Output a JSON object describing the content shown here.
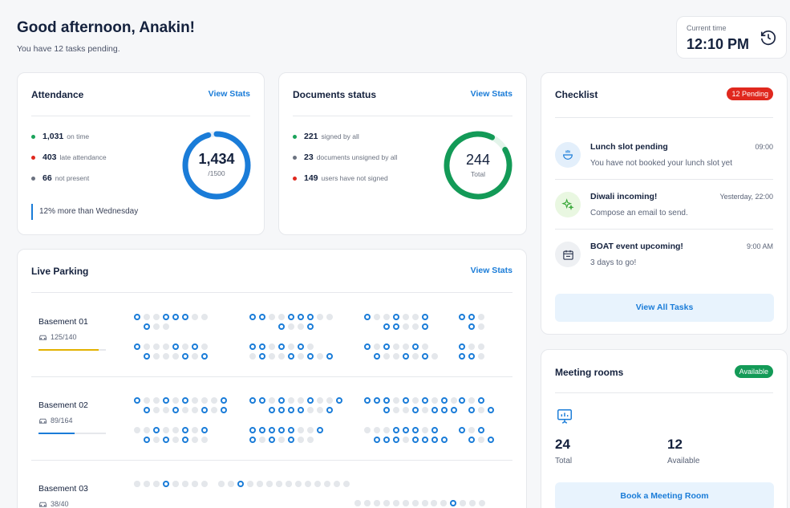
{
  "greeting": {
    "title": "Good afternoon, Anakin!",
    "subtitle": "You have 12 tasks pending."
  },
  "time": {
    "label": "Current time",
    "value": "12:10 PM",
    "icon": "clock-icon"
  },
  "attendance": {
    "title": "Attendance",
    "action": "View Stats",
    "rows": [
      {
        "value": "1,031",
        "label": "on time",
        "color": "#1aa35a"
      },
      {
        "value": "403",
        "label": "late attendance",
        "color": "#e0281e"
      },
      {
        "value": "66",
        "label": "not present",
        "color": "#6b7280"
      }
    ],
    "total": "1,434",
    "total_sub": "/1500",
    "ratio": 0.956,
    "note": "12% more than Wednesday"
  },
  "documents": {
    "title": "Documents status",
    "action": "View Stats",
    "rows": [
      {
        "value": "221",
        "label": "signed by all",
        "color": "#1aa35a"
      },
      {
        "value": "23",
        "label": "documents unsigned by all",
        "color": "#6b7280"
      },
      {
        "value": "149",
        "label": "users have not signed",
        "color": "#e0281e"
      }
    ],
    "total": "244",
    "total_sub": "Total",
    "ratio": 0.906
  },
  "checklist": {
    "title": "Checklist",
    "badge": "12 Pending",
    "items": [
      {
        "title": "Lunch slot pending",
        "sub": "You have not booked your lunch slot yet",
        "time": "09:00",
        "icon": "food-bowl-icon",
        "bg": "#e3effb"
      },
      {
        "title": "Diwali incoming!",
        "sub": "Compose an email to send.",
        "time": "Yesterday, 22:00",
        "icon": "sparkle-icon",
        "bg": "#e9f7e1"
      },
      {
        "title": "BOAT event upcoming!",
        "sub": "3 days to go!",
        "time": "9:00 AM",
        "icon": "calendar-icon",
        "bg": "#eef0f3"
      }
    ],
    "button": "View All Tasks"
  },
  "parking": {
    "title": "Live Parking",
    "action": "View Stats",
    "basements": [
      {
        "name": "Basement 01",
        "capacity": "125/140",
        "ratio": 0.89,
        "color": "#e2b100"
      },
      {
        "name": "Basement 02",
        "capacity": "89/164",
        "ratio": 0.54,
        "color": "#1a7cd8"
      },
      {
        "name": "Basement 03",
        "capacity": "38/40",
        "ratio": 0.95,
        "color": "#1a7cd8"
      }
    ]
  },
  "meeting": {
    "title": "Meeting rooms",
    "badge": "Available",
    "total": "24",
    "total_label": "Total",
    "available": "12",
    "available_label": "Available",
    "button": "Book a Meeting Room"
  }
}
